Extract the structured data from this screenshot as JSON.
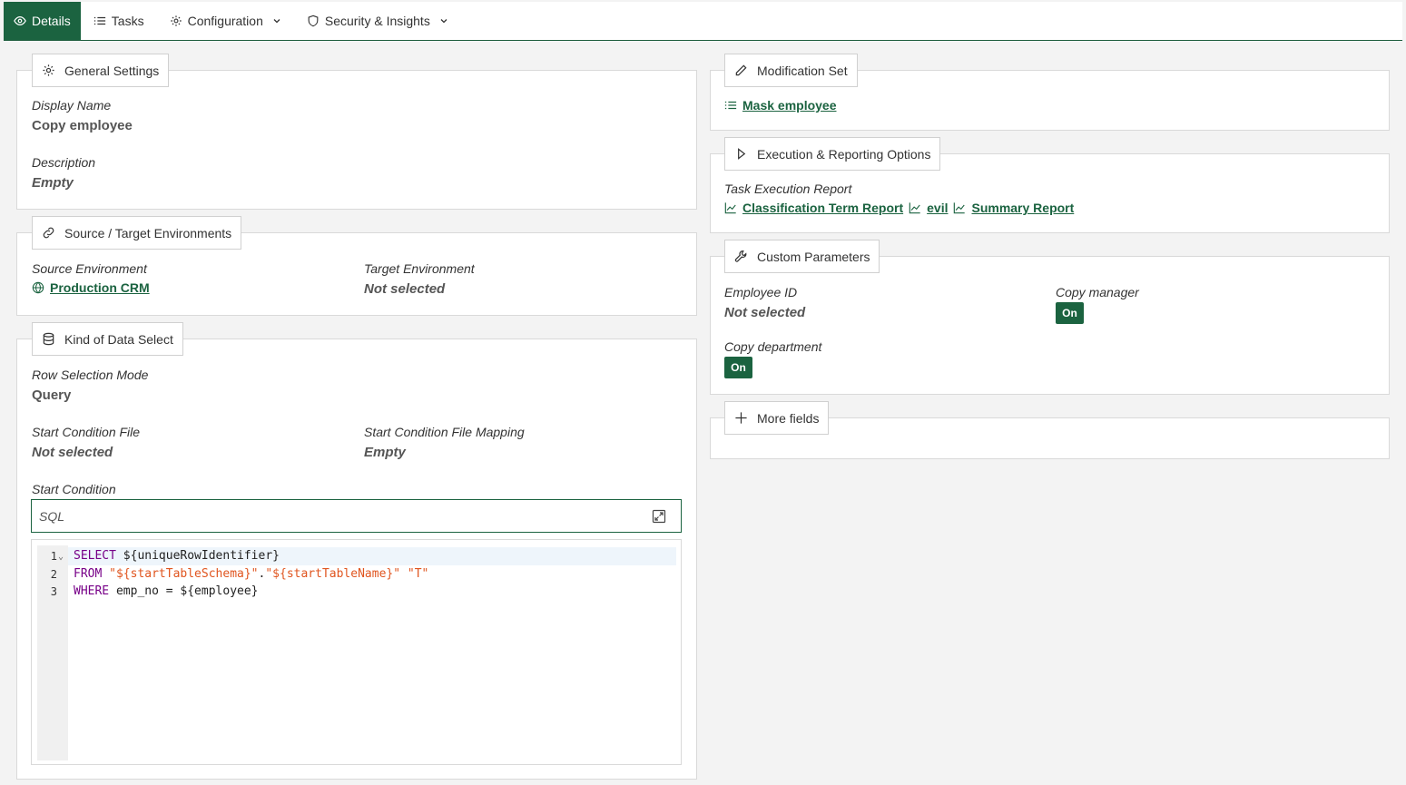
{
  "tabs": [
    {
      "label": "Details",
      "icon": "eye-icon",
      "active": true
    },
    {
      "label": "Tasks",
      "icon": "list-icon"
    },
    {
      "label": "Configuration",
      "icon": "gear-icon",
      "dropdown": true
    },
    {
      "label": "Security & Insights",
      "icon": "shield-icon",
      "dropdown": true
    }
  ],
  "general": {
    "title": "General Settings",
    "display_name_label": "Display Name",
    "display_name": "Copy employee",
    "description_label": "Description",
    "description": "Empty"
  },
  "environments": {
    "title": "Source / Target Environments",
    "source_label": "Source Environment",
    "source": "Production CRM",
    "target_label": "Target Environment",
    "target": "Not selected"
  },
  "kind": {
    "title": "Kind of Data Select",
    "row_mode_label": "Row Selection Mode",
    "row_mode": "Query",
    "start_file_label": "Start Condition File",
    "start_file": "Not selected",
    "start_mapping_label": "Start Condition File Mapping",
    "start_mapping": "Empty",
    "start_condition_label": "Start Condition",
    "sql_mode": "SQL",
    "code": {
      "line1_num": "1",
      "line2_num": "2",
      "line3_num": "3",
      "l1_kw": "SELECT",
      "l1_rest": " ${uniqueRowIdentifier}",
      "l2_kw": "FROM",
      "l2_s1": "\"${startTableSchema}\"",
      "l2_dot": ".",
      "l2_s2": "\"${startTableName}\"",
      "l2_s3": "\"T\"",
      "l3_kw": "WHERE",
      "l3_rest": " emp_no = ${employee}"
    }
  },
  "modification": {
    "title": "Modification Set",
    "link": "Mask employee"
  },
  "execution": {
    "title": "Execution & Reporting Options",
    "report_label": "Task Execution Report",
    "reports": [
      "Classification Term Report",
      "evil",
      "Summary Report"
    ]
  },
  "custom": {
    "title": "Custom Parameters",
    "employee_id_label": "Employee ID",
    "employee_id": "Not selected",
    "copy_manager_label": "Copy manager",
    "copy_manager": "On",
    "copy_department_label": "Copy department",
    "copy_department": "On"
  },
  "more": {
    "title": "More fields"
  },
  "colors": {
    "accent": "#1b6340",
    "string": "#e0551f",
    "keyword": "#770088"
  }
}
